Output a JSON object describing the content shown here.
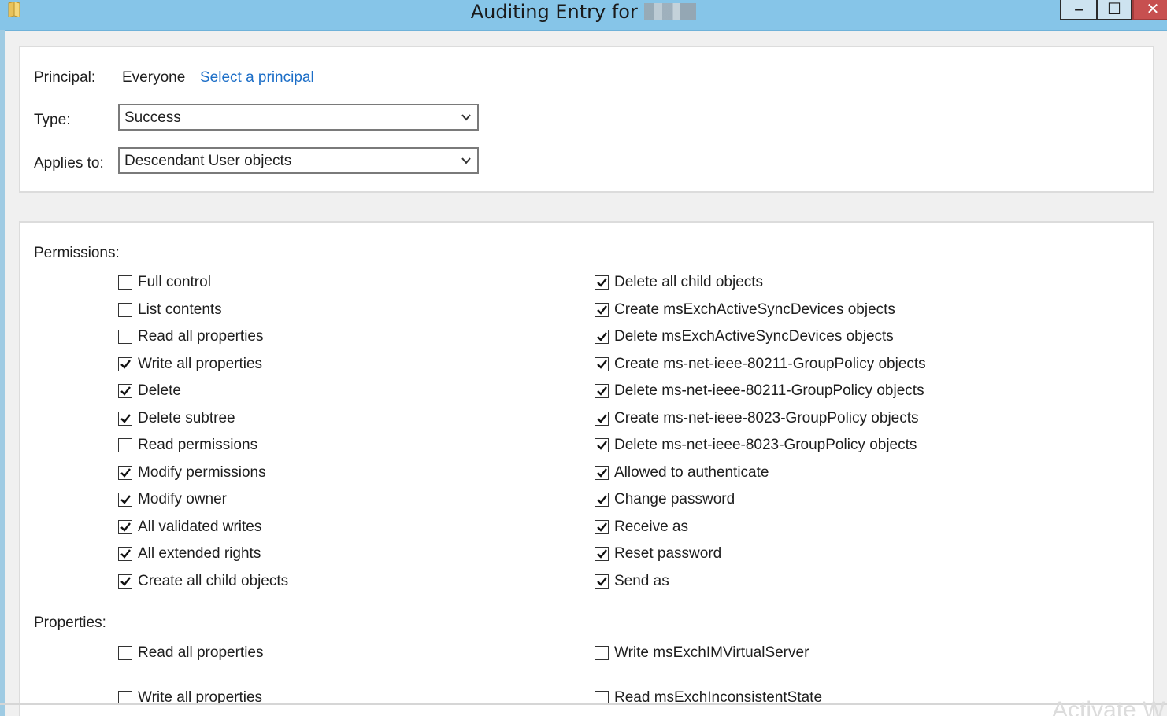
{
  "window": {
    "title": "Auditing Entry for",
    "minimize_glyph": "–",
    "maximize_glyph": "☐",
    "close_glyph": "✕"
  },
  "principal": {
    "label": "Principal:",
    "value": "Everyone",
    "link": "Select a principal"
  },
  "type": {
    "label": "Type:",
    "selected": "Success"
  },
  "applies_to": {
    "label": "Applies to:",
    "selected": "Descendant User objects"
  },
  "permissions": {
    "title": "Permissions:",
    "left": [
      {
        "label": "Full control",
        "checked": false
      },
      {
        "label": "List contents",
        "checked": false
      },
      {
        "label": "Read all properties",
        "checked": false
      },
      {
        "label": "Write all properties",
        "checked": true
      },
      {
        "label": "Delete",
        "checked": true
      },
      {
        "label": "Delete subtree",
        "checked": true
      },
      {
        "label": "Read permissions",
        "checked": false
      },
      {
        "label": "Modify permissions",
        "checked": true
      },
      {
        "label": "Modify owner",
        "checked": true
      },
      {
        "label": "All validated writes",
        "checked": true
      },
      {
        "label": "All extended rights",
        "checked": true
      },
      {
        "label": "Create all child objects",
        "checked": true
      }
    ],
    "right": [
      {
        "label": "Delete all child objects",
        "checked": true
      },
      {
        "label": "Create msExchActiveSyncDevices objects",
        "checked": true
      },
      {
        "label": "Delete msExchActiveSyncDevices objects",
        "checked": true
      },
      {
        "label": "Create ms-net-ieee-80211-GroupPolicy objects",
        "checked": true
      },
      {
        "label": "Delete ms-net-ieee-80211-GroupPolicy objects",
        "checked": true
      },
      {
        "label": "Create ms-net-ieee-8023-GroupPolicy objects",
        "checked": true
      },
      {
        "label": "Delete ms-net-ieee-8023-GroupPolicy objects",
        "checked": true
      },
      {
        "label": "Allowed to authenticate",
        "checked": true
      },
      {
        "label": "Change password",
        "checked": true
      },
      {
        "label": "Receive as",
        "checked": true
      },
      {
        "label": "Reset password",
        "checked": true
      },
      {
        "label": "Send as",
        "checked": true
      }
    ]
  },
  "properties": {
    "title": "Properties:",
    "left": [
      {
        "label": "Read all properties",
        "checked": false
      },
      {
        "label": "Write all properties",
        "checked": false
      }
    ],
    "right": [
      {
        "label": "Write msExchIMVirtualServer",
        "checked": false
      },
      {
        "label": "Read msExchInconsistentState",
        "checked": false
      }
    ]
  },
  "watermark": "Activate W",
  "colors": {
    "titlebar": "#86c5e8",
    "link": "#1c6ec7",
    "close": "#c75050"
  }
}
